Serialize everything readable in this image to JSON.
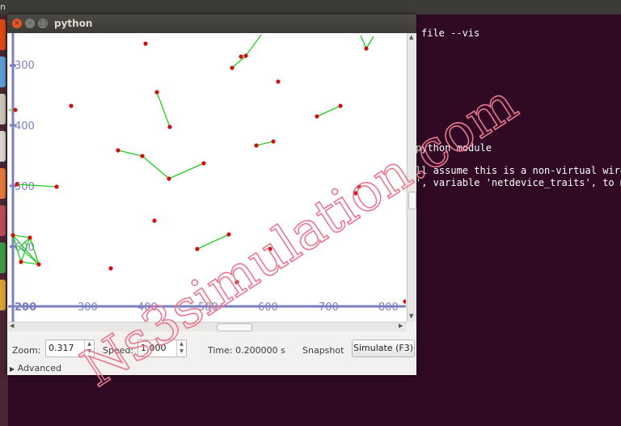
{
  "topbar": {
    "text": "n"
  },
  "terminal": {
    "lines": [
      {
        "text": "file --vis"
      },
      {
        "text": "python module"
      },
      {
        "text": "ll assume this is a non-virtual wire"
      },
      {
        "text": "', variable 'netdevice_traits', to m"
      }
    ]
  },
  "window": {
    "title": "python",
    "close_glyph": "×",
    "min_glyph": "–",
    "max_glyph": "□"
  },
  "canvas": {
    "y_ticks": [
      "300",
      "400",
      "500",
      "600"
    ],
    "y_bottom_label": "200",
    "x_ticks": [
      "300",
      "400",
      "500",
      "600",
      "700",
      "800"
    ],
    "axis_color": "#7b7fc2",
    "node_color": "#cc1111",
    "link_color": "#22cc22"
  },
  "controls": {
    "zoom_label": "Zoom:",
    "zoom_value": "0.317",
    "speed_label": "Speed:",
    "speed_value": "1.000",
    "time_label": "Time: 0.200000 s",
    "snapshot_label": "Snapshot",
    "simulate_label": "Simulate (F3)",
    "advanced_label": "Advanced",
    "expander_glyph": "▶"
  },
  "watermark": {
    "text": "Ns3simulation.com",
    "color": "#e8788e"
  }
}
